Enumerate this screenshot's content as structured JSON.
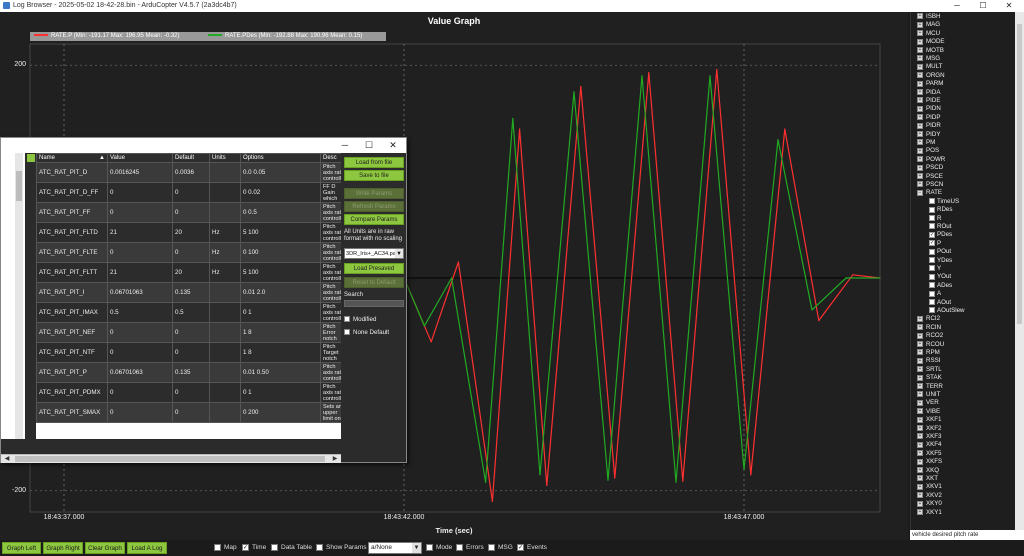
{
  "window": {
    "title": "Log Browser - 2025-05-02 18-42-28.bin - ArduCopter V4.5.7 (2a3dc4b7)",
    "minimize": "─",
    "maximize": "☐",
    "close": "✕"
  },
  "graph": {
    "title": "Value Graph",
    "legend": [
      {
        "label": "RATE.P  (Min: -191.17 Max: 196.95 Mean: -0.32)",
        "color": "#ff3030"
      },
      {
        "label": "RATE.PDes  (Min: -192.88 Max: 190.96 Mean: 0.15)",
        "color": "#22aa22"
      }
    ],
    "x_axis_label": "Time (sec)",
    "x_ticks": [
      "18:43:37.000",
      "18:43:42.000",
      "18:43:47.000"
    ],
    "y_ticks": [
      "200",
      "-200"
    ]
  },
  "chart_data": {
    "type": "line",
    "title": "Value Graph",
    "xlabel": "Time (sec)",
    "ylabel": "",
    "x_axis_time_ticks": [
      "18:43:37.000",
      "18:43:42.000",
      "18:43:47.000"
    ],
    "xlim_seconds_from_18_43_37": [
      -0.5,
      12.0
    ],
    "ylim": [
      -220,
      220
    ],
    "series": [
      {
        "name": "RATE.P",
        "color": "#ff3030",
        "x": [
          5.0,
          5.4,
          5.8,
          6.3,
          6.7,
          7.1,
          7.6,
          8.1,
          8.6,
          9.1,
          9.6,
          10.1,
          10.6,
          11.1,
          11.6,
          12.0
        ],
        "y": [
          0,
          -60,
          15,
          -210,
          140,
          -195,
          180,
          -188,
          193,
          -191,
          196,
          -185,
          140,
          -40,
          3,
          0
        ]
      },
      {
        "name": "RATE.PDes",
        "color": "#22aa22",
        "x": [
          5.0,
          5.3,
          5.7,
          6.2,
          6.6,
          7.0,
          7.5,
          8.0,
          8.5,
          9.0,
          9.5,
          10.0,
          10.5,
          11.0,
          11.5,
          12.0
        ],
        "y": [
          0,
          -45,
          0,
          -192,
          150,
          -185,
          175,
          -190,
          190,
          -192,
          190,
          -180,
          130,
          -30,
          0,
          0
        ]
      }
    ]
  },
  "tree": {
    "items": [
      {
        "label": "ISBH",
        "type": "group"
      },
      {
        "label": "MAG",
        "type": "group"
      },
      {
        "label": "MCU",
        "type": "group"
      },
      {
        "label": "MODE",
        "type": "group"
      },
      {
        "label": "MOTB",
        "type": "group"
      },
      {
        "label": "MSG",
        "type": "group"
      },
      {
        "label": "MULT",
        "type": "group"
      },
      {
        "label": "ORGN",
        "type": "group"
      },
      {
        "label": "PARM",
        "type": "group"
      },
      {
        "label": "PIDA",
        "type": "group"
      },
      {
        "label": "PIDE",
        "type": "group"
      },
      {
        "label": "PIDN",
        "type": "group"
      },
      {
        "label": "PIDP",
        "type": "group"
      },
      {
        "label": "PIDR",
        "type": "group"
      },
      {
        "label": "PIDY",
        "type": "group"
      },
      {
        "label": "PM",
        "type": "group"
      },
      {
        "label": "POS",
        "type": "group"
      },
      {
        "label": "POWR",
        "type": "group"
      },
      {
        "label": "PSCD",
        "type": "group"
      },
      {
        "label": "PSCE",
        "type": "group"
      },
      {
        "label": "PSCN",
        "type": "group"
      },
      {
        "label": "RATE",
        "type": "expanded"
      },
      {
        "label": "TimeUS",
        "type": "field",
        "checked": false
      },
      {
        "label": "RDes",
        "type": "field",
        "checked": false
      },
      {
        "label": "R",
        "type": "field",
        "checked": false
      },
      {
        "label": "ROut",
        "type": "field",
        "checked": false
      },
      {
        "label": "PDes",
        "type": "field",
        "checked": true
      },
      {
        "label": "P",
        "type": "field",
        "checked": true
      },
      {
        "label": "POut",
        "type": "field",
        "checked": false
      },
      {
        "label": "YDes",
        "type": "field",
        "checked": false
      },
      {
        "label": "Y",
        "type": "field",
        "checked": false
      },
      {
        "label": "YOut",
        "type": "field",
        "checked": false
      },
      {
        "label": "ADes",
        "type": "field",
        "checked": false
      },
      {
        "label": "A",
        "type": "field",
        "checked": false
      },
      {
        "label": "AOut",
        "type": "field",
        "checked": false
      },
      {
        "label": "AOutSlew",
        "type": "field",
        "checked": false
      },
      {
        "label": "RCI2",
        "type": "group"
      },
      {
        "label": "RCIN",
        "type": "group"
      },
      {
        "label": "RCO2",
        "type": "group"
      },
      {
        "label": "RCOU",
        "type": "group"
      },
      {
        "label": "RPM",
        "type": "group"
      },
      {
        "label": "RSSI",
        "type": "group"
      },
      {
        "label": "SRTL",
        "type": "group"
      },
      {
        "label": "STAK",
        "type": "group"
      },
      {
        "label": "TERR",
        "type": "group"
      },
      {
        "label": "UNIT",
        "type": "group"
      },
      {
        "label": "VER",
        "type": "group"
      },
      {
        "label": "VIBE",
        "type": "group"
      },
      {
        "label": "XKF1",
        "type": "group"
      },
      {
        "label": "XKF2",
        "type": "group"
      },
      {
        "label": "XKF3",
        "type": "group"
      },
      {
        "label": "XKF4",
        "type": "group"
      },
      {
        "label": "XKF5",
        "type": "group"
      },
      {
        "label": "XKFS",
        "type": "group"
      },
      {
        "label": "XKQ",
        "type": "group"
      },
      {
        "label": "XKT",
        "type": "group"
      },
      {
        "label": "XKV1",
        "type": "group"
      },
      {
        "label": "XKV2",
        "type": "group"
      },
      {
        "label": "XKY0",
        "type": "group"
      },
      {
        "label": "XKY1",
        "type": "group"
      }
    ]
  },
  "status_bar": {
    "text": "vehicle desired pitch rate"
  },
  "bottom_bar": {
    "buttons": [
      "Graph Left",
      "Graph Right",
      "Clear Graph",
      "Load A Log"
    ],
    "checkboxes": [
      {
        "label": "Map",
        "checked": false
      },
      {
        "label": "Time",
        "checked": true
      },
      {
        "label": "Data Table",
        "checked": false
      },
      {
        "label": "Show Params",
        "checked": false
      }
    ],
    "combo_value": "a/None",
    "checkboxes2": [
      {
        "label": "Mode",
        "checked": false
      },
      {
        "label": "Errors",
        "checked": false
      },
      {
        "label": "MSG",
        "checked": false
      },
      {
        "label": "Events",
        "checked": true
      }
    ]
  },
  "params_dialog": {
    "columns": [
      "Name",
      "Value",
      "Default",
      "Units",
      "Options",
      "Desc"
    ],
    "sort_indicator": "▲",
    "rows": [
      {
        "name": "ATC_RAT_PIT_D",
        "value": "0.0016245",
        "default": "0.0036",
        "units": "",
        "options": "0.0 0.05",
        "desc": "Pitch axis rate controller"
      },
      {
        "name": "ATC_RAT_PIT_D_FF",
        "value": "0",
        "default": "0",
        "units": "",
        "options": "0 0.02",
        "desc": "FF D Gain which"
      },
      {
        "name": "ATC_RAT_PIT_FF",
        "value": "0",
        "default": "0",
        "units": "",
        "options": "0 0.5",
        "desc": "Pitch axis rate controller"
      },
      {
        "name": "ATC_RAT_PIT_FLTD",
        "value": "21",
        "default": "20",
        "units": "Hz",
        "options": "5 100",
        "desc": "Pitch axis rate controller"
      },
      {
        "name": "ATC_RAT_PIT_FLTE",
        "value": "0",
        "default": "0",
        "units": "Hz",
        "options": "0 100",
        "desc": "Pitch axis rate controller"
      },
      {
        "name": "ATC_RAT_PIT_FLTT",
        "value": "21",
        "default": "20",
        "units": "Hz",
        "options": "5 100",
        "desc": "Pitch axis rate controller"
      },
      {
        "name": "ATC_RAT_PIT_I",
        "value": "0.06701063",
        "default": "0.135",
        "units": "",
        "options": "0.01 2.0",
        "desc": "Pitch axis rate controller"
      },
      {
        "name": "ATC_RAT_PIT_IMAX",
        "value": "0.5",
        "default": "0.5",
        "units": "",
        "options": "0 1",
        "desc": "Pitch axis rate controller"
      },
      {
        "name": "ATC_RAT_PIT_NEF",
        "value": "0",
        "default": "0",
        "units": "",
        "options": "1 8",
        "desc": "Pitch Error notch"
      },
      {
        "name": "ATC_RAT_PIT_NTF",
        "value": "0",
        "default": "0",
        "units": "",
        "options": "1 8",
        "desc": "Pitch Target notch"
      },
      {
        "name": "ATC_RAT_PIT_P",
        "value": "0.06701063",
        "default": "0.135",
        "units": "",
        "options": "0.01 0.50",
        "desc": "Pitch axis rate controller"
      },
      {
        "name": "ATC_RAT_PIT_PDMX",
        "value": "0",
        "default": "0",
        "units": "",
        "options": "0 1",
        "desc": "Pitch axis rate controller"
      },
      {
        "name": "ATC_RAT_PIT_SMAX",
        "value": "0",
        "default": "0",
        "units": "",
        "options": "0 200",
        "desc": "Sets an upper limit on"
      }
    ],
    "panel": {
      "load_from_file": "Load from file",
      "save_to_file": "Save to file",
      "write_params": "Write Params",
      "refresh_params": "Refresh Params",
      "compare_params": "Compare Params",
      "units_note": "All Units are in raw format with no scaling",
      "preset_value": "3DR_Iris+_AC34.pa",
      "load_presaved": "Load Presaved",
      "reset_to_default": "Reset to Default",
      "search_label": "Search",
      "modified_label": "Modified",
      "none_default_label": "None Default"
    }
  }
}
